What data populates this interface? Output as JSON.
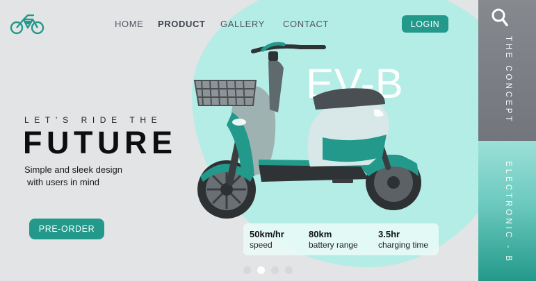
{
  "header": {
    "logo_icon": "bicycle-logo-icon",
    "nav": [
      {
        "label": "HOME",
        "active": false
      },
      {
        "label": "PRODUCT",
        "active": true
      },
      {
        "label": "GALLERY",
        "active": false
      },
      {
        "label": "CONTACT",
        "active": false
      }
    ],
    "login_label": "LOGIN"
  },
  "hero": {
    "tagline": "LET’S RIDE THE",
    "headline": "FUTURE",
    "subtitle_line1": "Simple and sleek design",
    "subtitle_line2": "with users in mind",
    "preorder_label": "PRE-ORDER",
    "model_name": "EV-B"
  },
  "specs": [
    {
      "value": "50km/hr",
      "label": "speed"
    },
    {
      "value": "80km",
      "label": "battery range"
    },
    {
      "value": "3.5hr",
      "label": "charging time"
    }
  ],
  "carousel": {
    "count": 4,
    "active_index": 1
  },
  "rail": {
    "search_icon": "search-icon",
    "top_label": "THE CONCEPT",
    "bottom_label": "ELECTRONIC - B"
  },
  "colors": {
    "accent": "#23998b",
    "mint": "#b4ece6",
    "background": "#e3e4e6",
    "rail_gray": "#7c8085"
  }
}
